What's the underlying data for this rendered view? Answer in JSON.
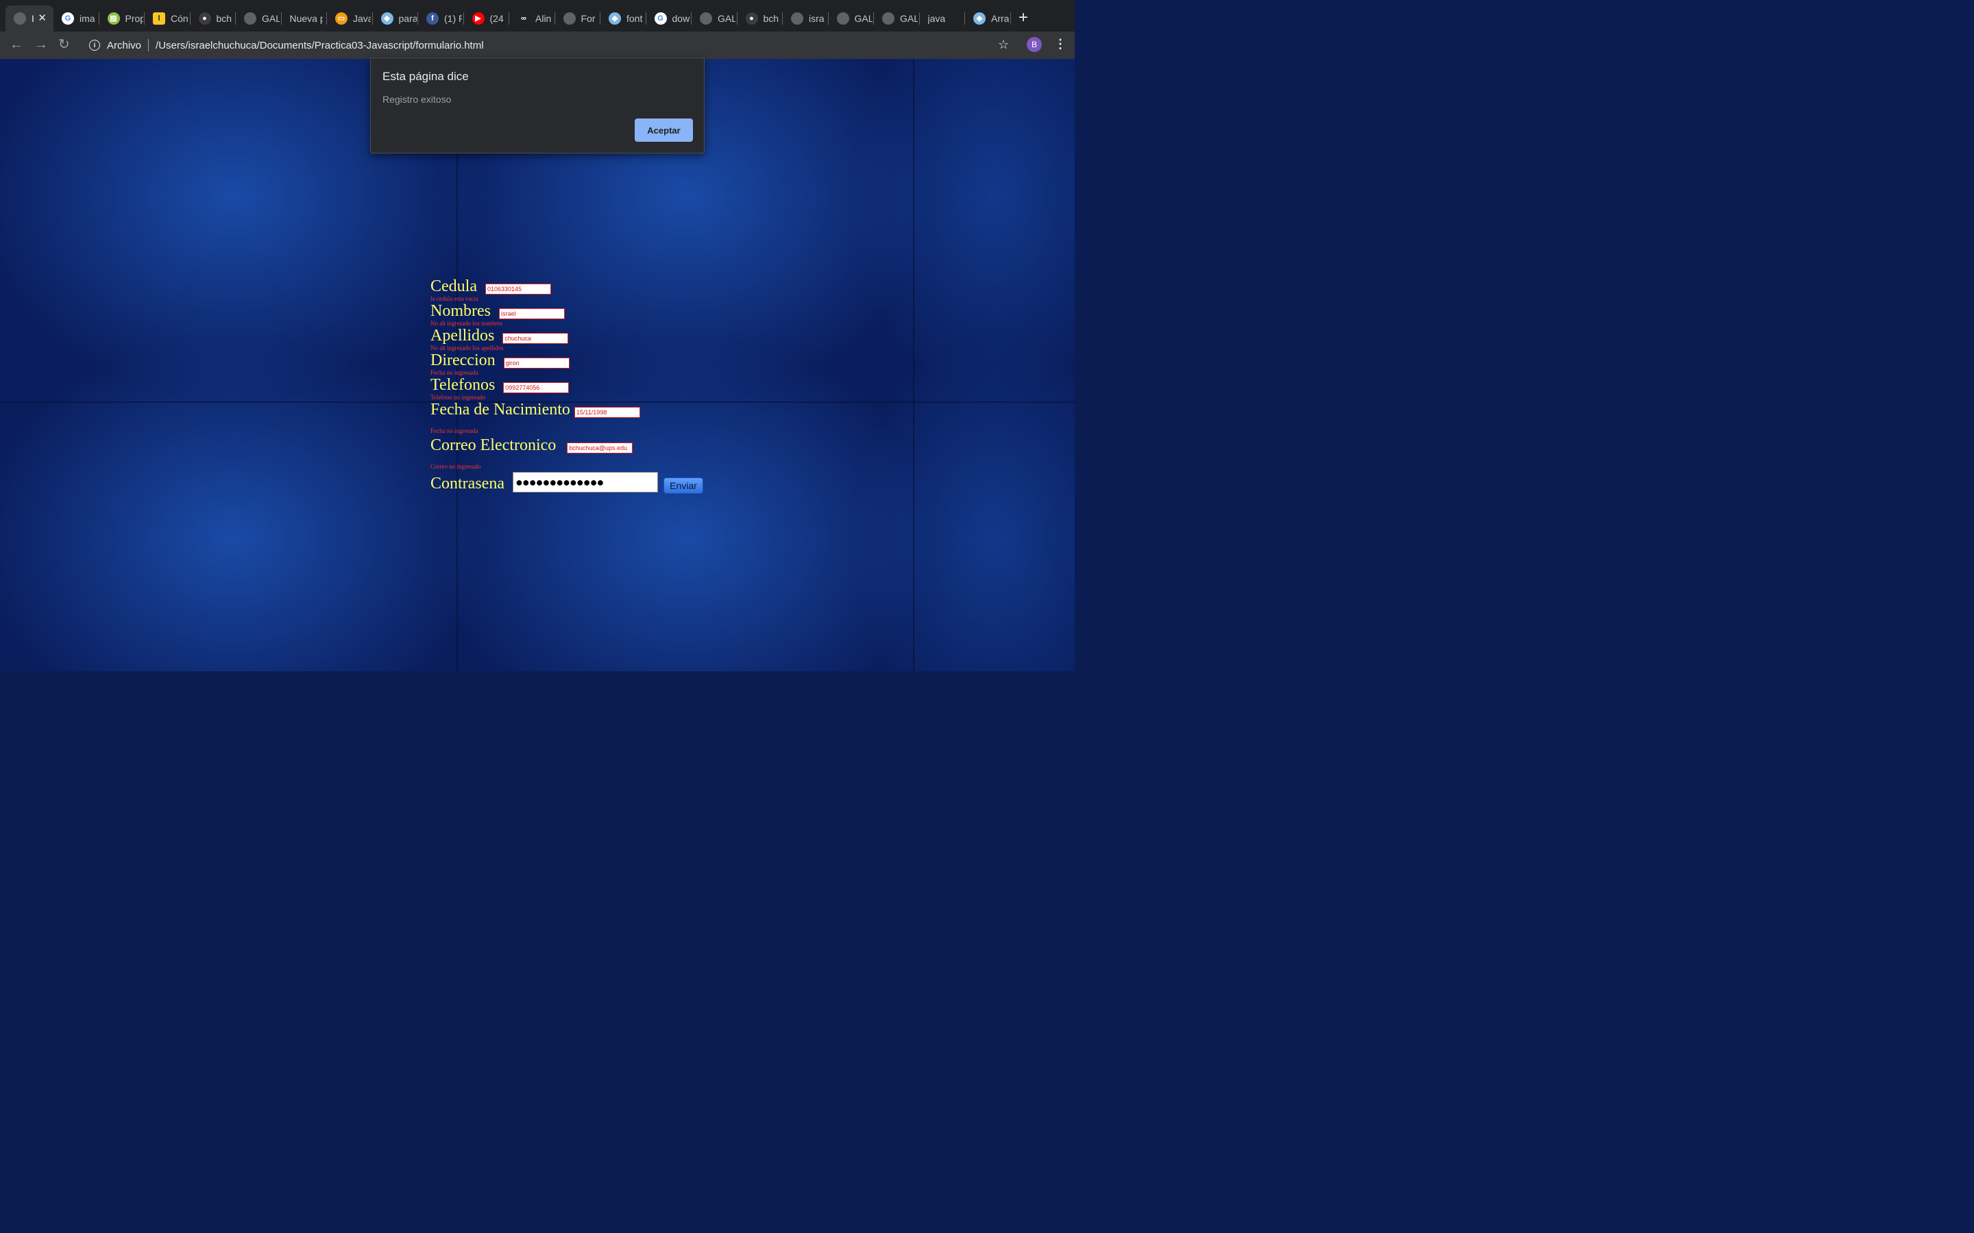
{
  "browser": {
    "tabs": [
      {
        "label": "I",
        "icon": "globe-icon",
        "color": "#5f6368",
        "glyph": ""
      },
      {
        "label": "ima",
        "icon": "google-icon",
        "color": "#ffffff",
        "glyph": "G"
      },
      {
        "label": "Prop",
        "icon": "chart-icon",
        "color": "#8bc34a",
        "glyph": "▤"
      },
      {
        "label": "Cón",
        "icon": "bookmark-icon",
        "color": "#f9c623",
        "glyph": "l"
      },
      {
        "label": "bch",
        "icon": "github-icon",
        "color": "#3c3c3c",
        "glyph": "●"
      },
      {
        "label": "GAL",
        "icon": "globe-icon",
        "color": "#5f6368",
        "glyph": ""
      },
      {
        "label": "Nueva p",
        "icon": "",
        "color": "",
        "glyph": ""
      },
      {
        "label": "Java",
        "icon": "presentation-icon",
        "color": "#f39c12",
        "glyph": "▭"
      },
      {
        "label": "para",
        "icon": "bird-icon",
        "color": "#7fb7e6",
        "glyph": "◆"
      },
      {
        "label": "(1) F",
        "icon": "facebook-icon",
        "color": "#3b5998",
        "glyph": "f"
      },
      {
        "label": "(24",
        "icon": "youtube-icon",
        "color": "#ff0000",
        "glyph": "▶"
      },
      {
        "label": "Alin",
        "icon": "link-icon",
        "color": "#202124",
        "glyph": "∞"
      },
      {
        "label": "For",
        "icon": "globe-icon",
        "color": "#5f6368",
        "glyph": ""
      },
      {
        "label": "font",
        "icon": "bird-icon",
        "color": "#7fb7e6",
        "glyph": "◆"
      },
      {
        "label": "dow",
        "icon": "google-icon",
        "color": "#ffffff",
        "glyph": "G"
      },
      {
        "label": "GAL",
        "icon": "globe-icon",
        "color": "#5f6368",
        "glyph": ""
      },
      {
        "label": "bch",
        "icon": "github-icon",
        "color": "#3c3c3c",
        "glyph": "●"
      },
      {
        "label": "isra",
        "icon": "globe-icon",
        "color": "#5f6368",
        "glyph": ""
      },
      {
        "label": "GAL",
        "icon": "globe-icon",
        "color": "#5f6368",
        "glyph": ""
      },
      {
        "label": "GAL",
        "icon": "globe-icon",
        "color": "#5f6368",
        "glyph": ""
      },
      {
        "label": "java",
        "icon": "",
        "color": "",
        "glyph": ""
      },
      {
        "label": "Arra",
        "icon": "bird-icon",
        "color": "#7fb7e6",
        "glyph": "◆"
      }
    ],
    "new_tab": "+",
    "url_scheme_label": "Archivo",
    "url": "/Users/israelchuchuca/Documents/Practica03-Javascript/formulario.html",
    "profile_initial": "B"
  },
  "dialog": {
    "title": "Esta página dice",
    "message": "Registro exitoso",
    "ok_label": "Aceptar"
  },
  "form": {
    "cedula": {
      "label": "Cedula",
      "value": "0106330145",
      "error": "la cedula esta vacia"
    },
    "nombres": {
      "label": "Nombres",
      "value": "israel",
      "error": "No ah ingresado los nombres"
    },
    "apellidos": {
      "label": "Apellidos",
      "value": "chuchuca",
      "error": "No ah ingresado los apellidos"
    },
    "direccion": {
      "label": "Direccion",
      "value": "giron",
      "error": "Fecha no ingresada"
    },
    "telefonos": {
      "label": "Telefonos",
      "value": "0992774056",
      "error": "Telefono no ingresado"
    },
    "fecha": {
      "label": "Fecha de Nacimiento",
      "value": "15/11/1998",
      "error": "Fecha no ingresada"
    },
    "correo": {
      "label": "Correo Electronico",
      "value": "bchuchuca@ups.edu",
      "error": "Correo no ingresado"
    },
    "contrasena": {
      "label": "Contrasena",
      "masked_value": "●●●●●●●●●●●●●"
    },
    "submit_label": "Enviar"
  },
  "colors": {
    "label_yellow": "#ffff66",
    "error_red": "#ff3030",
    "dialog_button": "#8ab4f8"
  }
}
